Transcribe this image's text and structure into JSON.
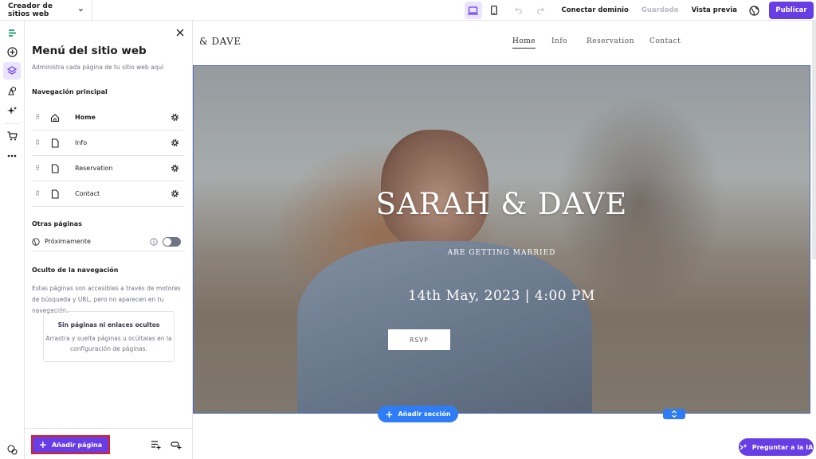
{
  "topbar": {
    "site_builder_label": "Creador de sitios web",
    "connect_domain": "Conectar dominio",
    "saved": "Guardado",
    "preview": "Vista previa",
    "publish": "Publicar"
  },
  "panel": {
    "title": "Menú del sitio web",
    "subtitle": "Administra cada página de tu sitio web aquí",
    "main_nav_heading": "Navegación principal",
    "main_nav_items": [
      {
        "label": "Home",
        "icon": "home-icon"
      },
      {
        "label": "Info",
        "icon": "page-icon"
      },
      {
        "label": "Reservation",
        "icon": "page-icon"
      },
      {
        "label": "Contact",
        "icon": "page-icon"
      }
    ],
    "other_pages_heading": "Otras páginas",
    "coming_soon_label": "Próximamente",
    "hidden_heading": "Oculto de la navegación",
    "hidden_description": "Estas páginas son accesibles a través de motores de búsqueda y URL, pero no aparecen en tu navegación.",
    "empty_title": "Sin páginas ni enlaces ocultos",
    "empty_description": "Arrastra y suelta páginas u ocúltalas en la configuración de páginas.",
    "add_page": "Añadir página"
  },
  "site": {
    "logo": "& DAVE",
    "nav": [
      "Home",
      "Info",
      "Reservation",
      "Contact"
    ],
    "hero_title": "SARAH & DAVE",
    "hero_subtitle": "ARE GETTING MARRIED",
    "hero_date": "14th May, 2023 | 4:00 PM",
    "rsvp": "RSVP"
  },
  "canvas": {
    "add_section": "Añadir sección",
    "ask_ai": "Preguntar a la IA"
  },
  "colors": {
    "accent": "#673de6",
    "highlight": "#e0201b",
    "editor_blue": "#2f7df6"
  }
}
